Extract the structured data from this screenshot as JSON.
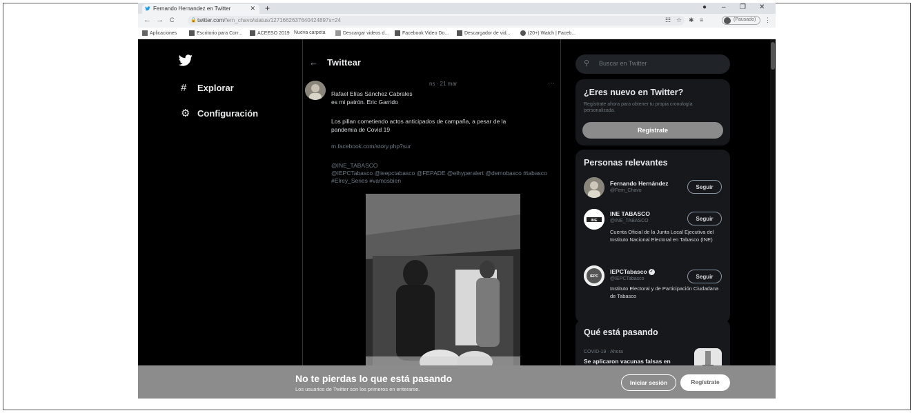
{
  "browser": {
    "tab_title": "Fernando Hernandez en Twitter",
    "tab_close": "✕",
    "new_tab": "+",
    "window_controls": [
      "●",
      "–",
      "❐",
      "✕"
    ],
    "nav_back": "←",
    "nav_forward": "→",
    "nav_reload": "C",
    "url_host": "twitter.com",
    "url_path": "/fern_chavo/status/1271662637640424897s=24",
    "profile_label": "(Pausado)",
    "bookmarks": [
      "Aplicaciones",
      "Escritorio para Corr...",
      "ACEESO 2019",
      "Nueva carpeta",
      "Descargar videos d...",
      "Facebook Video Do...",
      "Descargador de vid...",
      "(20+) Watch | Faceb..."
    ]
  },
  "sidebar": {
    "items": [
      {
        "icon": "#",
        "label": "Explorar"
      },
      {
        "icon": "⚙",
        "label": "Configuración"
      }
    ]
  },
  "tweet_header": {
    "back": "←",
    "title": "Twittear"
  },
  "tweet": {
    "meta": "ns · 21 mar",
    "more": "···",
    "lines": [
      "Rafael Elías Sánchez Cabrales",
      "es mi patrón. Eric Garrido",
      "Los pillan cometiendo actos anticipados de campaña, a pesar de la",
      "pandemia de Covid 19"
    ],
    "link": "m.facebook.com/story.php?sur",
    "mentions": [
      "@INE_TABASCO",
      "@IEPCTabasco @ieepctabasco @FEPADE @elhyperalert @demobasco #tabasco",
      "#Elrey_Series #vamosbien"
    ]
  },
  "right": {
    "search_placeholder": "Buscar en Twitter",
    "signup_card": {
      "title": "¿Eres nuevo en Twitter?",
      "subtitle": "Regístrate ahora para obtener tu propia cronología personalizada.",
      "button": "Regístrate"
    },
    "people": {
      "title": "Personas relevantes",
      "items": [
        {
          "name": "Fernando Hernández",
          "handle": "@Fern_Chavo",
          "bio": "",
          "follow": "Seguir"
        },
        {
          "name": "INE TABASCO",
          "handle": "@INE_TABASCO",
          "bio": "Cuenta Oficial de la Junta Local Ejecutiva del Instituto Nacional Electoral en Tabasco (INE)",
          "follow": "Seguir"
        },
        {
          "name": "IEPCTabasco",
          "handle": "@IEPCTabasco",
          "bio": "Instituto Electoral y de Participación Ciudadana de Tabasco",
          "follow": "Seguir"
        }
      ]
    },
    "trends": {
      "title": "Qué está pasando",
      "category": "COVID-19 · Ahora",
      "text": "Se aplicaron vacunas falsas en"
    }
  },
  "bottom_bar": {
    "title": "No te pierdas lo que está pasando",
    "subtitle": "Los usuarios de Twitter son los primeros en enterarse.",
    "login": "Iniciar sesión",
    "register": "Regístrate"
  }
}
